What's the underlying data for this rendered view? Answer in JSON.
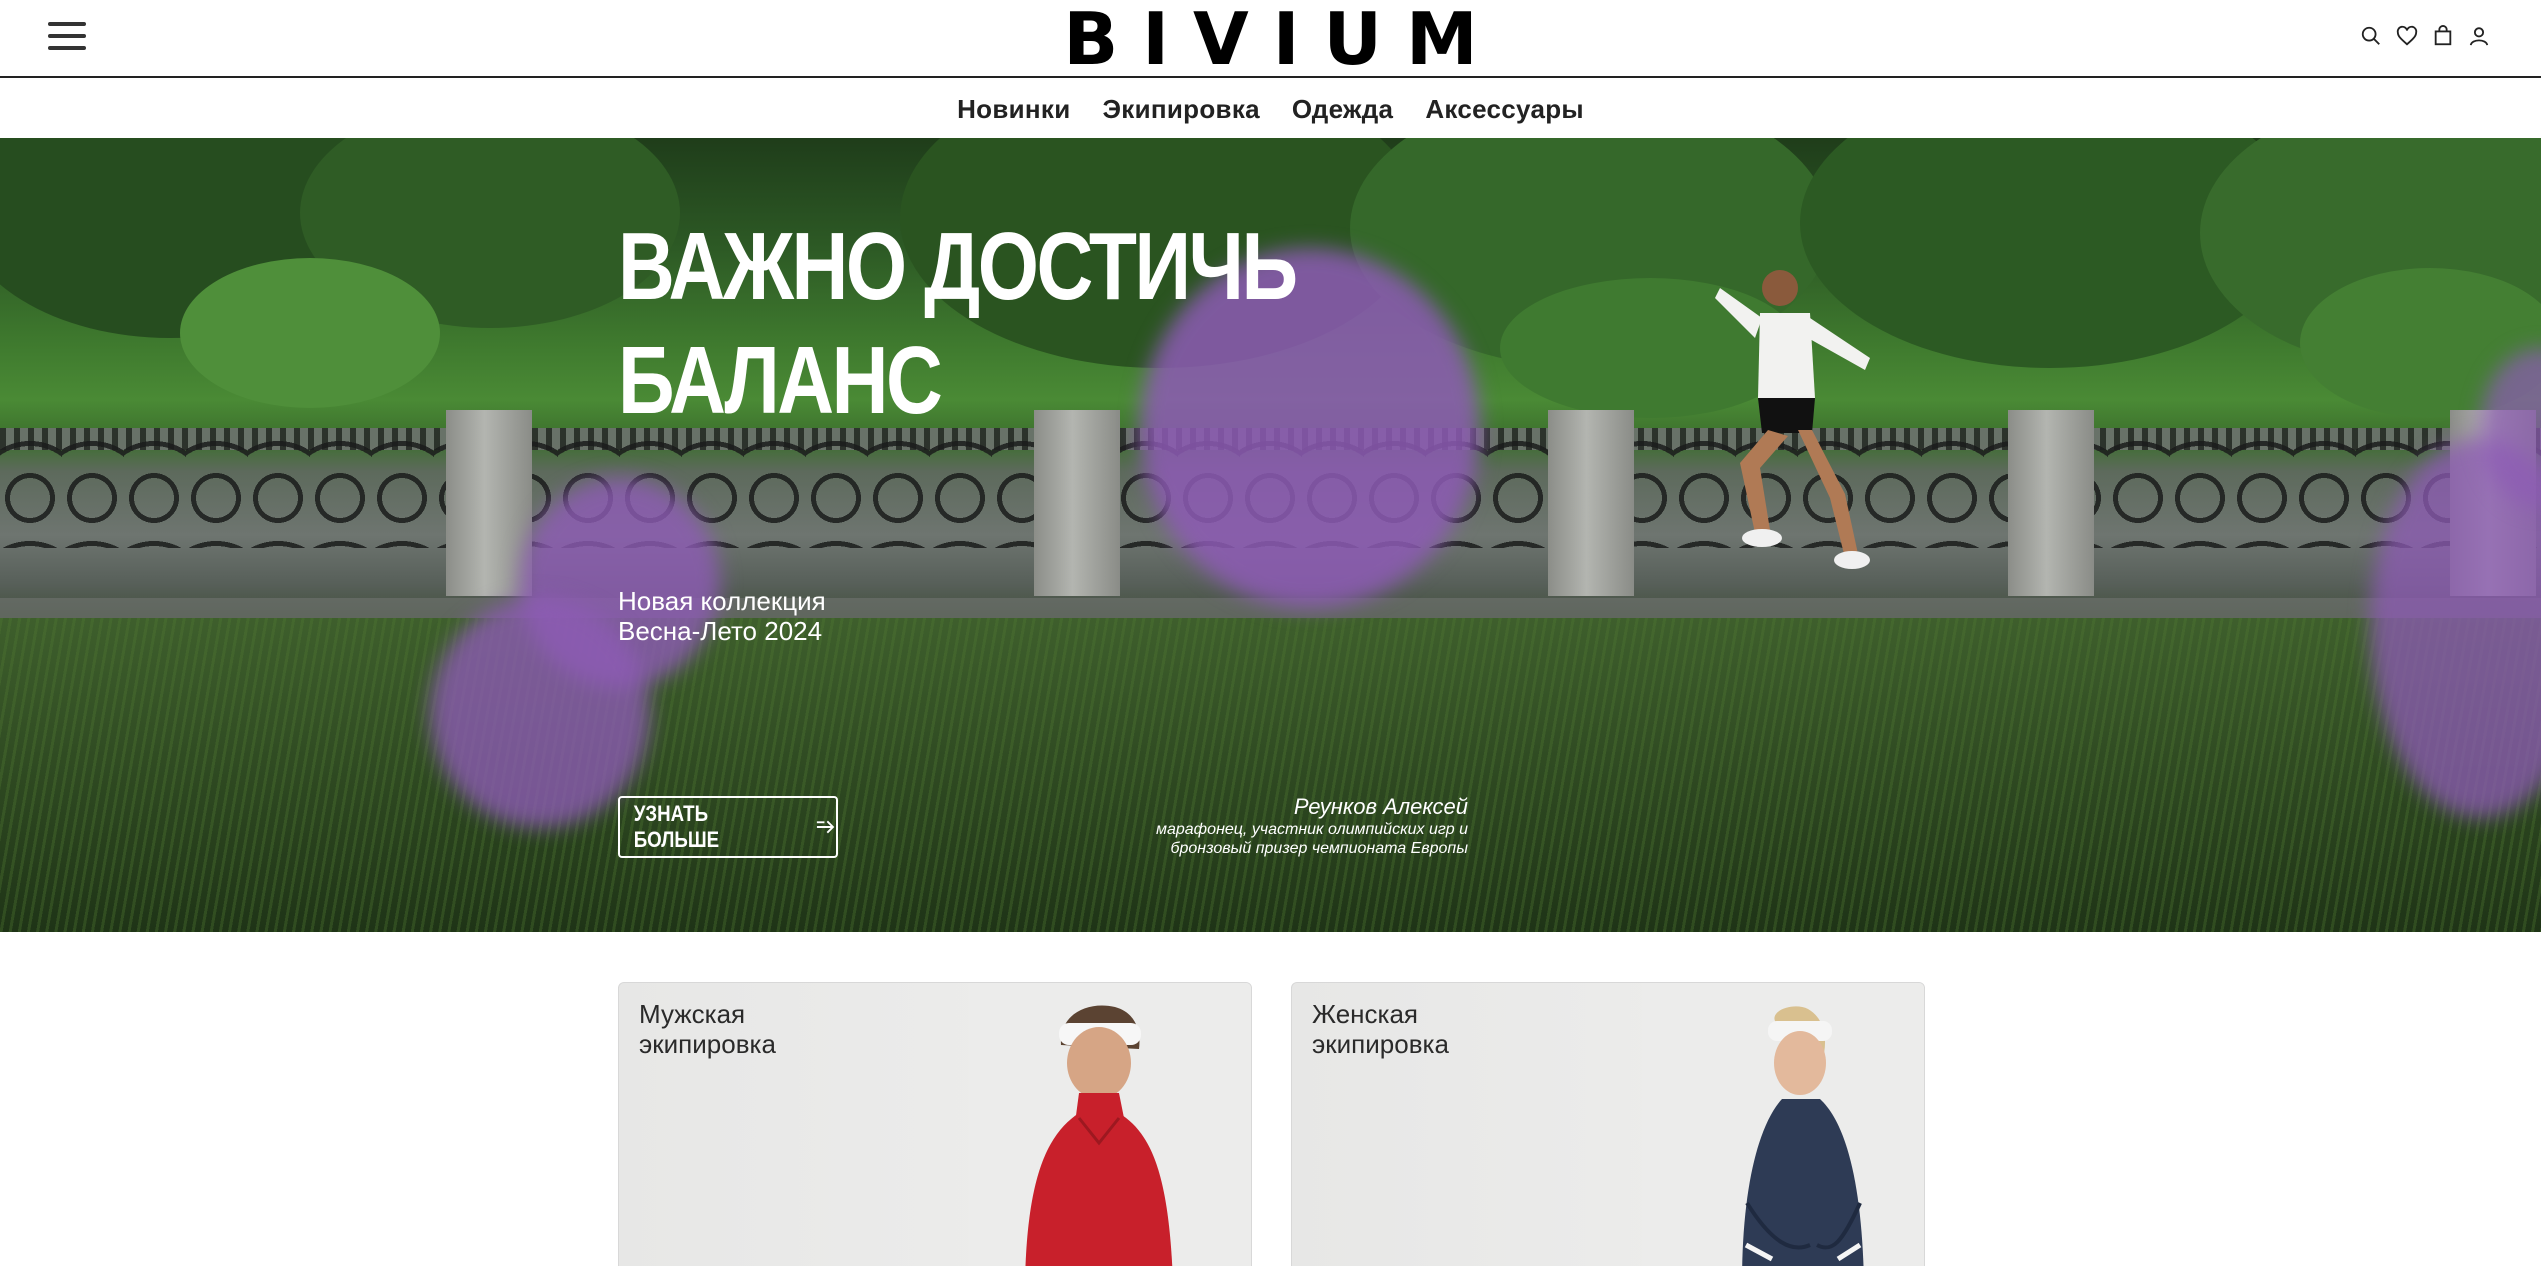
{
  "header": {
    "logo": "BIVIUM",
    "menu_icon": "hamburger-menu-icon",
    "icons": [
      "search-icon",
      "heart-icon",
      "bag-icon",
      "user-icon"
    ]
  },
  "nav": {
    "items": [
      "Новинки",
      "Экипировка",
      "Одежда",
      "Аксессуары"
    ]
  },
  "hero": {
    "title_line1": "ВАЖНО ДОСТИЧЬ",
    "title_line2": "БАЛАНС",
    "subtitle_line1": "Новая коллекция",
    "subtitle_line2": "Весна-Лето 2024",
    "button_label": "УЗНАТЬ БОЛЬШЕ",
    "quote_name": "Реунков Алексей",
    "quote_line1": "марафонец, участник олимпийских игр и",
    "quote_line2": "бронзовый призер чемпионата Европы"
  },
  "categories": [
    {
      "title_line1": "Мужская",
      "title_line2": "экипировка"
    },
    {
      "title_line1": "Женская",
      "title_line2": "экипировка"
    }
  ],
  "colors": {
    "accent": "#000000",
    "jacket_men": "#c8202b",
    "jacket_women": "#2e3b55",
    "flower": "#8d5bb5"
  }
}
